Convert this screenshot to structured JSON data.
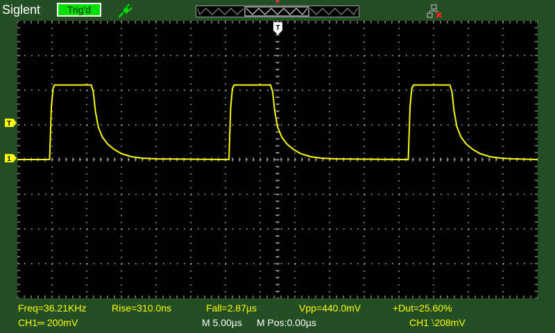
{
  "header": {
    "brand": "Siglent",
    "trigger_status": "Trig'd",
    "probe_icon": "probe-icon",
    "network_icon": "network-disconnected-icon"
  },
  "markers": {
    "trigger_level": "T",
    "channel1": "1",
    "trigger_position": "T"
  },
  "measurements": {
    "freq": "Freq=36.21KHz",
    "rise": "Rise=310.0ns",
    "fall": "Fall=2.87µs",
    "vpp": "Vpp=440.0mV",
    "duty": "+Dut=25.60%"
  },
  "status": {
    "ch1_scale": "CH1═ 200mV",
    "timebase": "M 5.00µs",
    "mpos": "M Pos:0.00µs",
    "trigger": "CH1 ⧵208mV"
  },
  "colors": {
    "trace": "#ffff00",
    "grid": "#c8c8c8",
    "trigger_ok": "#00e000",
    "background": "#244f24"
  },
  "chart_data": {
    "type": "line",
    "x_unit": "div",
    "y_unit": "div",
    "xlim": [
      0,
      15
    ],
    "ylim": [
      -4,
      4
    ],
    "grid": true,
    "series": [
      {
        "x": [
          0,
          0.93,
          0.98,
          1.03,
          1.07,
          2.13,
          2.19,
          2.25,
          2.33,
          2.45,
          2.6,
          2.78,
          3.0,
          3.3,
          3.6,
          4.0,
          6.1,
          6.1,
          6.15,
          6.2,
          6.25,
          7.3,
          7.36,
          7.42,
          7.5,
          7.62,
          7.77,
          7.95,
          8.17,
          8.47,
          8.77,
          9.17,
          11.25,
          11.27,
          11.32,
          11.37,
          11.42,
          12.47,
          12.53,
          12.59,
          12.67,
          12.79,
          12.94,
          13.12,
          13.34,
          13.64,
          13.94,
          14.34,
          15.0
        ],
        "y": [
          0,
          0,
          1.5,
          2.05,
          2.15,
          2.15,
          1.95,
          1.4,
          0.95,
          0.65,
          0.45,
          0.3,
          0.17,
          0.08,
          0.04,
          0.02,
          0,
          0,
          1.5,
          2.05,
          2.15,
          2.15,
          1.95,
          1.4,
          0.95,
          0.65,
          0.45,
          0.3,
          0.17,
          0.08,
          0.04,
          0.02,
          0,
          0,
          1.5,
          2.05,
          2.15,
          2.15,
          1.95,
          1.4,
          0.95,
          0.65,
          0.45,
          0.3,
          0.17,
          0.08,
          0.04,
          0.02,
          0
        ]
      }
    ]
  }
}
